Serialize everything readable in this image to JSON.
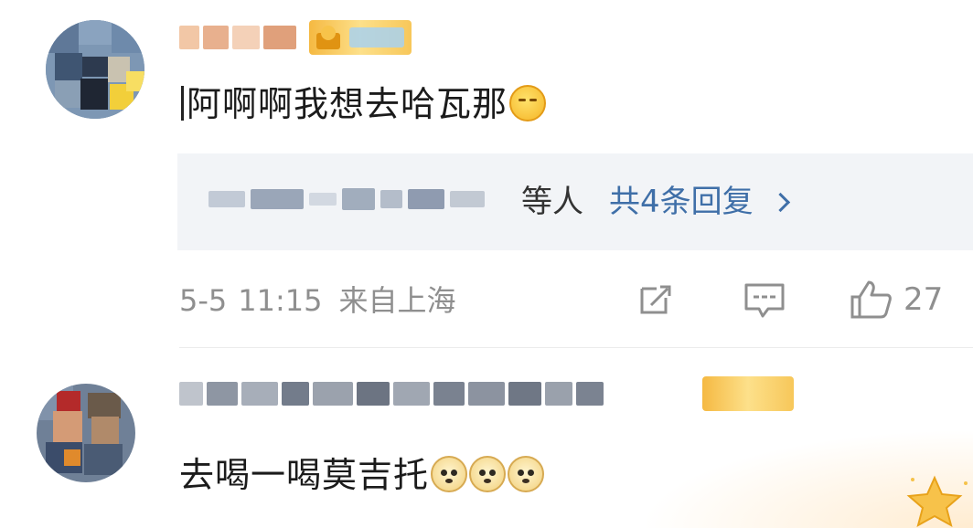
{
  "comments": [
    {
      "username_display": "（模糊处理）",
      "text": "阿啊啊我想去哈瓦那",
      "emoji": "yawn-face",
      "replies": {
        "suffix": "等人",
        "link": "共4条回复"
      },
      "meta": {
        "date": "5-5",
        "time": "11:15",
        "location": "来自上海"
      },
      "like_count": "27"
    },
    {
      "text": "去喝一喝莫吉托",
      "emojis": [
        "doge",
        "doge",
        "doge"
      ]
    }
  ],
  "icons": {
    "edit": "edit-icon",
    "comment": "comment-icon",
    "like": "thumbs-up-icon",
    "chevron": "chevron-right-icon",
    "badge": "vip-star-icon"
  },
  "colors": {
    "link": "#3f6fa8",
    "meta": "#8f8f8f",
    "reply_bg": "#f2f4f7",
    "badge_gold": "#f5b942"
  }
}
